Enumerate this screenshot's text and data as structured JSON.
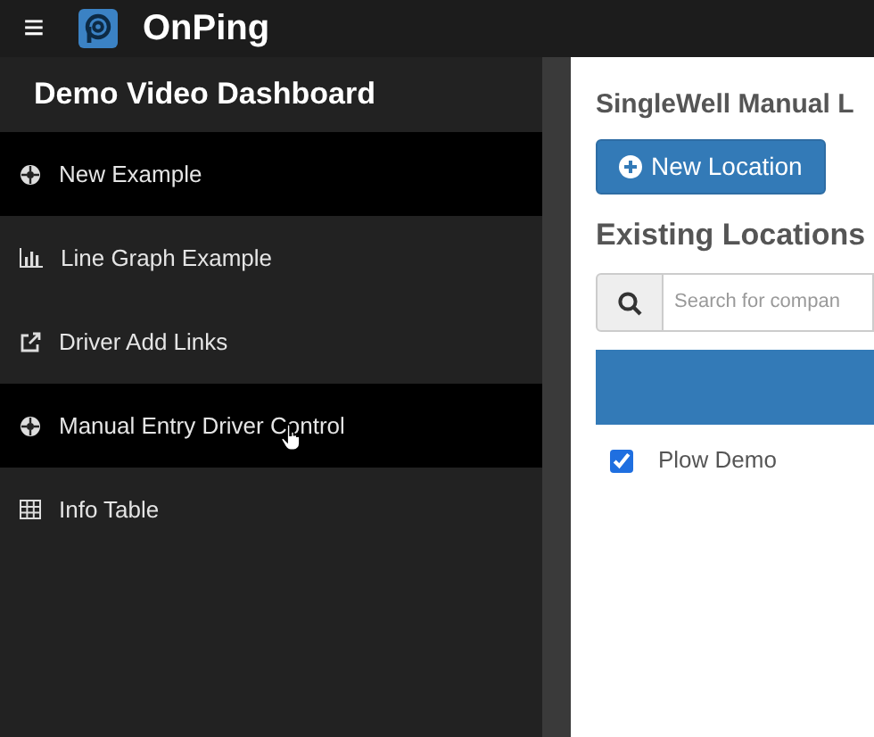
{
  "topbar": {
    "menu_glyph": "≡",
    "brand": "OnPing"
  },
  "sidebar": {
    "title": "Demo Video Dashboard",
    "items": [
      {
        "label": "New Example",
        "kind": "cog",
        "highlighted": true
      },
      {
        "label": "Line Graph Example",
        "kind": "chart",
        "highlighted": false
      },
      {
        "label": "Driver Add Links",
        "kind": "link",
        "highlighted": false
      },
      {
        "label": "Manual Entry Driver Control",
        "kind": "cog",
        "highlighted": true,
        "cursor": true
      },
      {
        "label": "Info Table",
        "kind": "table",
        "highlighted": false
      }
    ]
  },
  "main": {
    "title": "SingleWell Manual L",
    "new_button": "New Location",
    "section": "Existing Locations",
    "search": {
      "placeholder": "Search for compan"
    },
    "rows": [
      {
        "label": "Plow Demo",
        "checked": true
      }
    ]
  }
}
